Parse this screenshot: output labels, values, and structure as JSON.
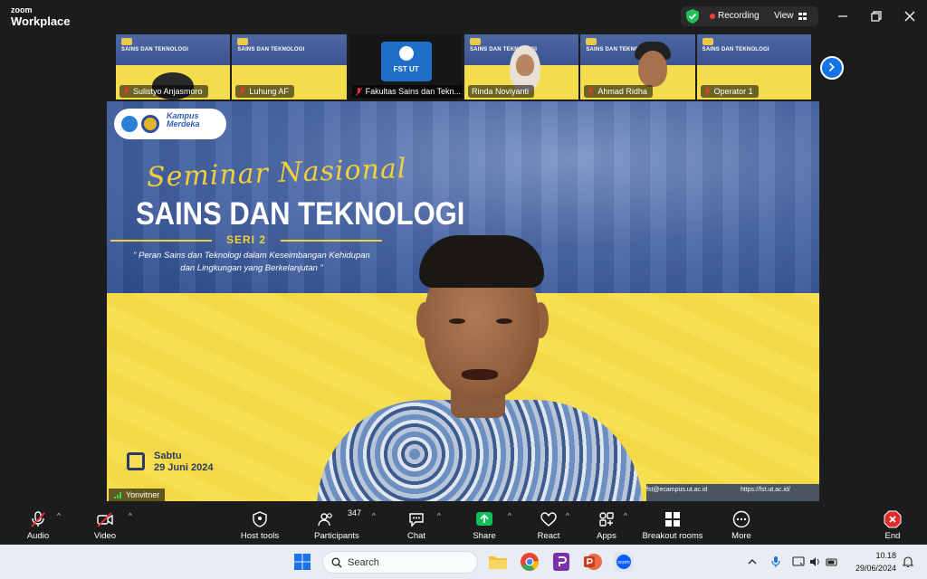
{
  "app": {
    "brand_line1": "zoom",
    "brand_line2": "Workplace"
  },
  "status": {
    "recording_label": "Recording",
    "view_label": "View"
  },
  "thumbnails": [
    {
      "name": "Sulistyo Anjasmoro",
      "slide_text": "SAINS DAN TEKNOLOGI"
    },
    {
      "name": "Luhung AF",
      "slide_text": "SAINS DAN TEKNOLOGI"
    },
    {
      "name": "Fakultas Sains dan Tekn...",
      "logo_text": "FST UT"
    },
    {
      "name": "Rinda Noviyanti",
      "slide_text": "SAINS DAN TEKNOLOGI"
    },
    {
      "name": "Ahmad Ridha",
      "slide_text": "SAINS DAN TEKNOLOGI"
    },
    {
      "name": "Operator 1",
      "slide_text": "SAINS DAN TEKNOLOGI"
    }
  ],
  "slide": {
    "logo_line1": "Kampus",
    "logo_line2": "Merdeka",
    "script_title": "Seminar Nasional",
    "title": "SAINS DAN TEKNOLOGI",
    "series": "SERI 2",
    "subtitle_line1": "“ Peran Sains dan Teknologi dalam Keseimbangan Kehidupan",
    "subtitle_line2": "dan Lingkungan yang Berkelanjutan ”",
    "day": "Sabtu",
    "date": "29 Juni 2024",
    "contact": "fst@ecampus.ut.ac.id",
    "website": "https://fst.ut.ac.id/"
  },
  "speaker": {
    "name": "Yonvitner"
  },
  "controls": {
    "audio": "Audio",
    "video": "Video",
    "host_tools": "Host tools",
    "participants": "Participants",
    "participants_count": "347",
    "chat": "Chat",
    "share": "Share",
    "react": "React",
    "apps": "Apps",
    "breakout": "Breakout rooms",
    "more": "More",
    "end": "End"
  },
  "taskbar": {
    "search_label": "Search",
    "time": "10.18",
    "date": "29/06/2024"
  },
  "colors": {
    "share_green": "#0fbf5c",
    "end_red": "#e02b2b",
    "accent_blue": "#1473e6",
    "slide_yellow": "#f3d946"
  },
  "icons": [
    "shield-check-icon",
    "grid-view-icon",
    "minimize-icon",
    "restore-icon",
    "close-icon",
    "mic-off-icon",
    "video-off-icon",
    "host-shield-icon",
    "participants-icon",
    "chat-icon",
    "share-arrow-icon",
    "heart-icon",
    "apps-icon",
    "breakout-grid-icon",
    "more-dots-icon",
    "end-x-icon",
    "windows-start-icon",
    "search-icon",
    "chevron-right-icon"
  ]
}
